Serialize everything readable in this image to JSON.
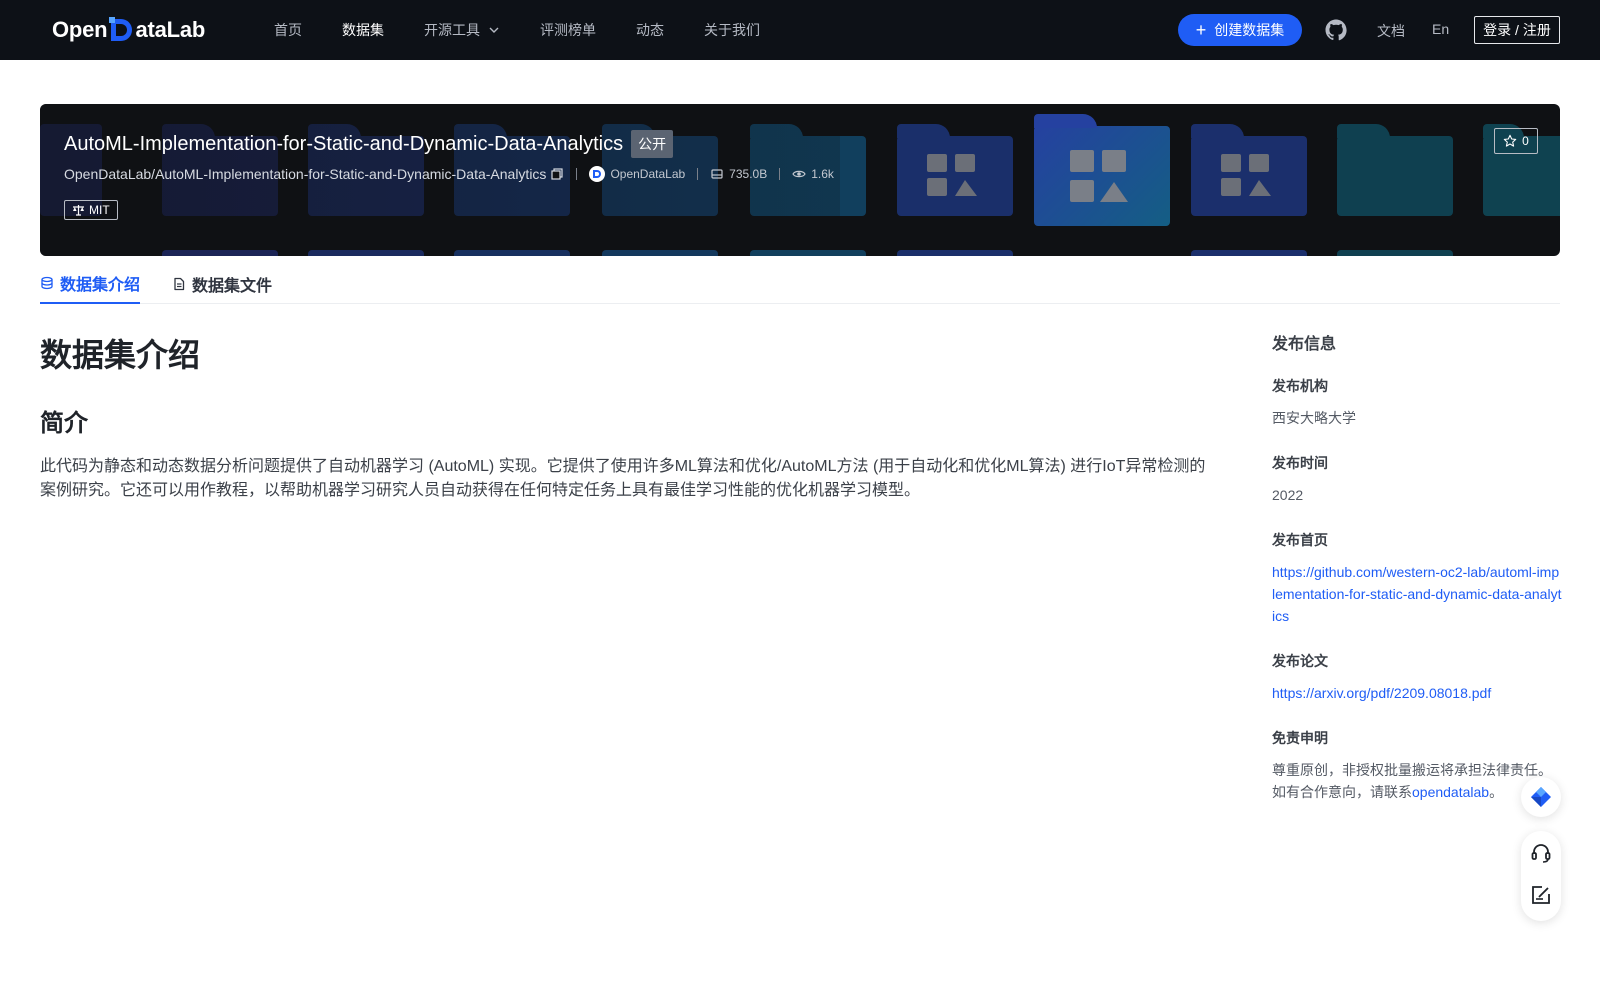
{
  "nav": {
    "logo_text_left": "Open",
    "logo_text_right": "ataLab",
    "links": [
      "首页",
      "数据集",
      "开源工具",
      "评测榜单",
      "动态",
      "关于我们"
    ],
    "create_label": "创建数据集",
    "docs_label": "文档",
    "lang_label": "En",
    "login_label": "登录 / 注册"
  },
  "dataset": {
    "name": "AutoML-Implementation-for-Static-and-Dynamic-Data-Analytics",
    "visibility": "公开",
    "full_path": "OpenDataLab/AutoML-Implementation-for-Static-and-Dynamic-Data-Analytics",
    "org": "OpenDataLab",
    "size": "735.0B",
    "views": "1.6k",
    "license": "MIT",
    "stars": "0"
  },
  "tabs": [
    "数据集介绍",
    "数据集文件"
  ],
  "content": {
    "title": "数据集介绍",
    "section": "简介",
    "description": "此代码为静态和动态数据分析问题提供了自动机器学习 (AutoML) 实现。它提供了使用许多ML算法和优化/AutoML方法 (用于自动化和优化ML算法) 进行IoT异常检测的案例研究。它还可以用作教程，以帮助机器学习研究人员自动获得在任何特定任务上具有最佳学习性能的优化机器学习模型。"
  },
  "sidebar": {
    "heading": "发布信息",
    "org_label": "发布机构",
    "org_value": "西安大略大学",
    "time_label": "发布时间",
    "time_value": "2022",
    "home_label": "发布首页",
    "home_value": "https://github.com/western-oc2-lab/automl-implementation-for-static-and-dynamic-data-analytics",
    "paper_label": "发布论文",
    "paper_value": "https://arxiv.org/pdf/2209.08018.pdf",
    "disclaimer_label": "免责申明",
    "disclaimer_text": "尊重原创，非授权批量搬运将承担法律责任。如有合作意向，请联系",
    "disclaimer_link": "opendatalab",
    "disclaimer_end": "。"
  },
  "colors": {
    "accent": "#1f5df5",
    "nav_bg": "#0d1117",
    "banner_bg": "#0f1114"
  },
  "icons": [
    "chevron-down-icon",
    "plus-icon",
    "github-icon",
    "copy-icon",
    "database-icon",
    "eye-icon",
    "scale-icon",
    "star-icon",
    "stack-icon",
    "file-icon",
    "diamond-icon",
    "headset-icon",
    "edit-icon"
  ]
}
